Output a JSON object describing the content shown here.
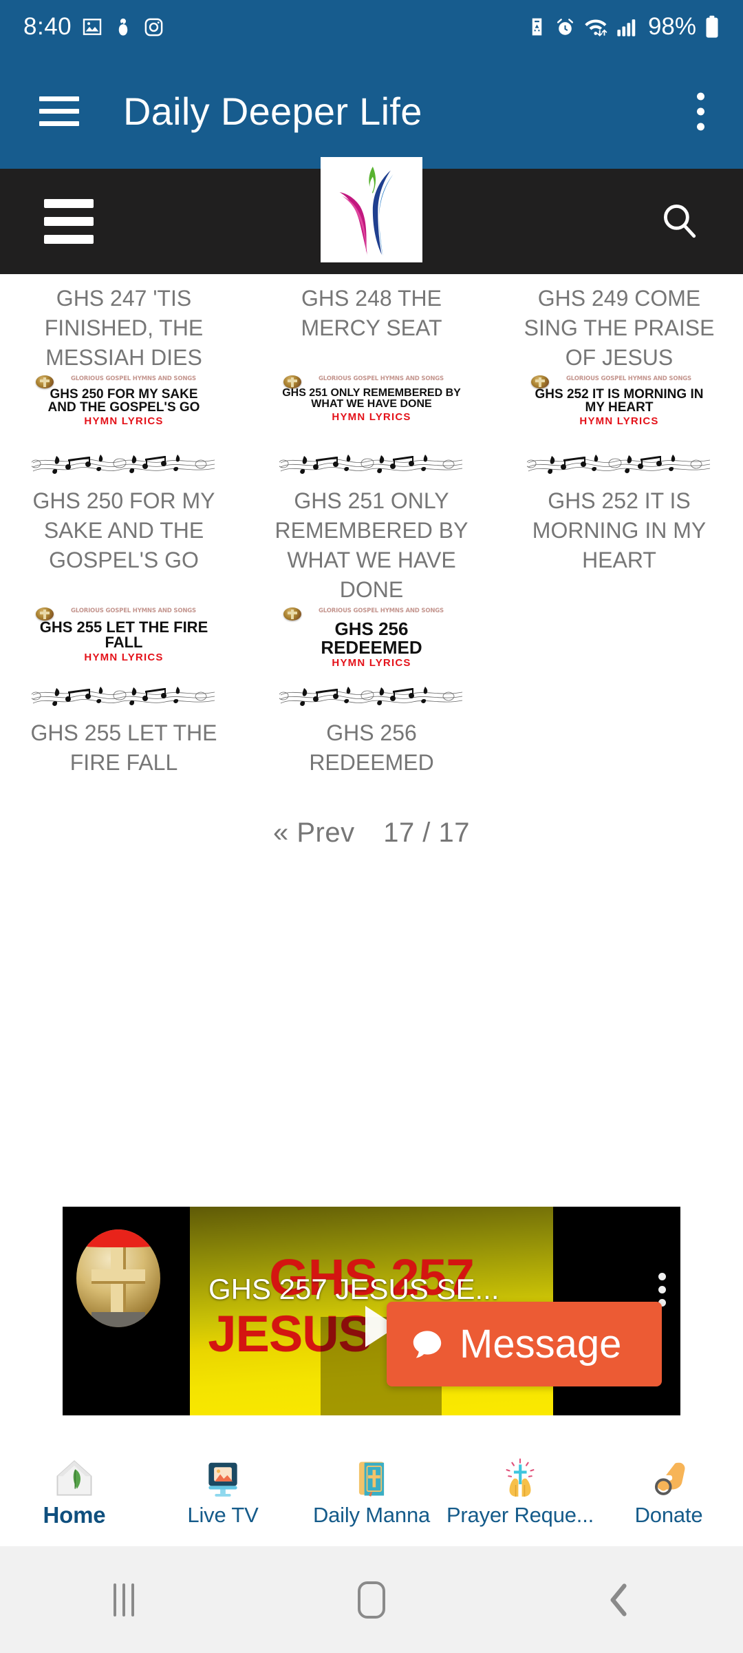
{
  "status_bar": {
    "time": "8:40",
    "battery_percent": "98%",
    "left_icons": [
      "gallery-icon",
      "snowman-icon",
      "instagram-icon"
    ],
    "right_icons": [
      "data-saver-icon",
      "alarm-icon",
      "wifi-icon",
      "signal-icon",
      "battery-icon"
    ],
    "background_color": "#175c8e"
  },
  "app_bar": {
    "title": "Daily Deeper Life",
    "menu_icon": "hamburger-icon",
    "overflow_icon": "kebab-menu-icon",
    "background_color": "#175c8e"
  },
  "site_bar": {
    "menu_icon": "hamburger-icon",
    "logo": "deeper-life-logo",
    "search_icon": "search-icon",
    "background_color": "#201f1f"
  },
  "brand_line": "GLORIOUS GOSPEL HYMNS AND SONGS",
  "lyrics_tag": "HYMN LYRICS",
  "hymns": [
    {
      "code": "GHS 247",
      "title": "'TIS FINISHED, THE MESSIAH DIES",
      "caption": "GHS 247 'TIS FINISHED, THE MESSIAH DIES",
      "has_thumb": false,
      "title_size": 0
    },
    {
      "code": "GHS 248",
      "title": "THE MERCY SEAT",
      "caption": "GHS 248 THE MERCY SEAT",
      "has_thumb": false,
      "title_size": 0
    },
    {
      "code": "GHS 249",
      "title": "COME SING THE PRAISE OF JESUS",
      "caption": "GHS 249 COME SING THE PRAISE OF JESUS",
      "has_thumb": false,
      "title_size": 0
    },
    {
      "code": "GHS 250",
      "title": "FOR MY SAKE AND THE GOSPEL'S GO",
      "caption": "GHS 250 FOR MY SAKE AND THE GOSPEL'S GO",
      "has_thumb": true,
      "title_size": 19
    },
    {
      "code": "GHS 251",
      "title": "ONLY REMEMBERED BY WHAT WE HAVE DONE",
      "caption": "GHS 251 ONLY REMEMBERED BY WHAT WE HAVE DONE",
      "has_thumb": true,
      "title_size": 16
    },
    {
      "code": "GHS 252",
      "title": "IT IS MORNING IN MY HEART",
      "caption": "GHS 252 IT IS MORNING IN MY HEART",
      "has_thumb": true,
      "title_size": 19
    },
    {
      "code": "GHS 255",
      "title": "LET THE FIRE FALL",
      "caption": "GHS 255 LET THE FIRE FALL",
      "has_thumb": true,
      "title_size": 22
    },
    {
      "code": "GHS 256",
      "title": "REDEEMED",
      "caption": "GHS 256 REDEEMED",
      "has_thumb": true,
      "title_size": 26
    }
  ],
  "pagination": {
    "prev_label": "« Prev",
    "page_indicator": "17 / 17"
  },
  "video": {
    "overlay_title": "GHS 257 JESUS SE...",
    "poster_text": "GHS 257 JESUS MORE",
    "play_icon": "play-icon",
    "kebab_icon": "kebab-menu-icon",
    "avatar": "cross-channel-avatar"
  },
  "message_button": {
    "label": "Message",
    "icon": "chat-bubble-icon",
    "color": "#ec5b34"
  },
  "bottom_nav": {
    "items": [
      {
        "label": "Home",
        "icon": "home-leaf-icon",
        "active": true
      },
      {
        "label": "Live TV",
        "icon": "monitor-icon",
        "active": false
      },
      {
        "label": "Daily Manna",
        "icon": "bible-icon",
        "active": false
      },
      {
        "label": "Prayer Reque...",
        "icon": "praying-hands-icon",
        "active": false
      },
      {
        "label": "Donate",
        "icon": "hand-coin-icon",
        "active": false
      }
    ],
    "accent_color": "#155b8a"
  },
  "android_nav": {
    "recents_icon": "recents-icon",
    "home_icon": "home-pill-icon",
    "back_icon": "back-chevron-icon"
  }
}
